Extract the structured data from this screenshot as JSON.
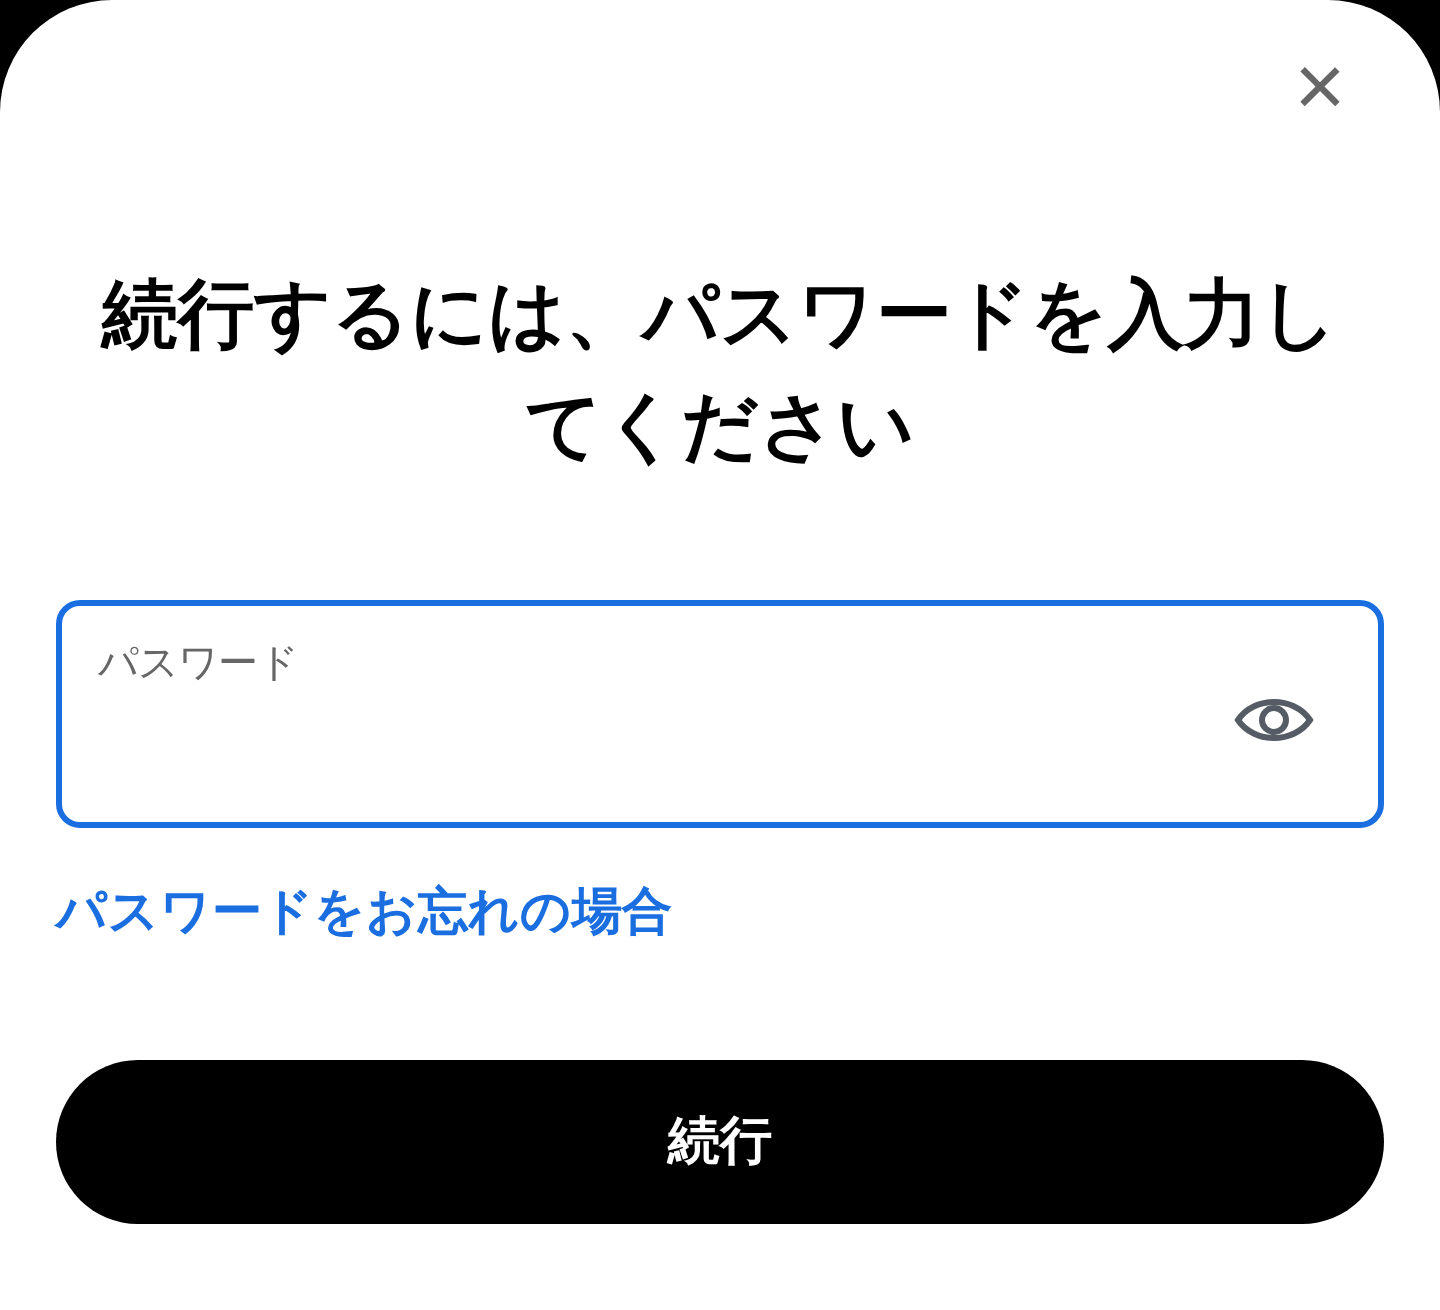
{
  "dialog": {
    "close_button": "×",
    "title": "続行するには、パスワードを入力してください",
    "password_field": {
      "label": "パスワード",
      "focused": true
    },
    "forgot_link": "パスワードをお忘れの場合",
    "continue_button": "続行"
  }
}
